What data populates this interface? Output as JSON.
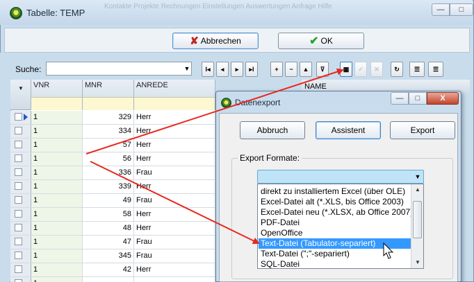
{
  "main_window": {
    "title": "Tabelle: TEMP",
    "background_tabs": "Kontakte  Projekte  Rechnungen  Einstellungen  Auswertungen  Anfrage  Hilfe",
    "min_symbol": "—",
    "close_symbol": "□"
  },
  "toolbar": {
    "cancel_label": "Abbrechen",
    "ok_label": "OK",
    "search_label": "Suche:",
    "search_value": "",
    "nav_buttons": [
      "I◂",
      "◂",
      "▸",
      "▸I",
      "+",
      "−",
      "▲",
      "⊽",
      "▦",
      "✓",
      "✕",
      "↻",
      "☰",
      "☰"
    ]
  },
  "grid": {
    "columns": [
      "VNR",
      "MNR",
      "ANREDE",
      "NAME"
    ],
    "rows": [
      {
        "vnr": "1",
        "mnr": "329",
        "anrede": "Herr"
      },
      {
        "vnr": "1",
        "mnr": "334",
        "anrede": "Herr"
      },
      {
        "vnr": "1",
        "mnr": "57",
        "anrede": "Herr"
      },
      {
        "vnr": "1",
        "mnr": "56",
        "anrede": "Herr"
      },
      {
        "vnr": "1",
        "mnr": "336",
        "anrede": "Frau"
      },
      {
        "vnr": "1",
        "mnr": "339",
        "anrede": "Herr"
      },
      {
        "vnr": "1",
        "mnr": "49",
        "anrede": "Frau"
      },
      {
        "vnr": "1",
        "mnr": "58",
        "anrede": "Herr"
      },
      {
        "vnr": "1",
        "mnr": "48",
        "anrede": "Herr"
      },
      {
        "vnr": "1",
        "mnr": "47",
        "anrede": "Frau"
      },
      {
        "vnr": "1",
        "mnr": "345",
        "anrede": "Frau"
      },
      {
        "vnr": "1",
        "mnr": "42",
        "anrede": "Herr"
      },
      {
        "vnr": "1",
        "mnr": "",
        "anrede": ""
      }
    ]
  },
  "dialog": {
    "title": "Datenexport",
    "abbruch_label": "Abbruch",
    "assistent_label": "Assistent",
    "export_label": "Export",
    "formats_label": "Export Formate:",
    "selected_value": "",
    "options": [
      "direkt zu installiertem Excel (über OLE)",
      "Excel-Datei  alt   (*.XLS, bis Office 2003)",
      "Excel-Datei neu  (*.XLSX, ab Office 2007)",
      "PDF-Datei",
      "OpenOffice",
      "Text-Datei (Tabulator-separiert)",
      "Text-Datei (\";\"-separiert)",
      "SQL-Datei"
    ],
    "selected_option_index": 5
  },
  "colors": {
    "arrow": "#e8281e",
    "selection": "#3399ff",
    "filter_row": "#fbf8d2"
  }
}
